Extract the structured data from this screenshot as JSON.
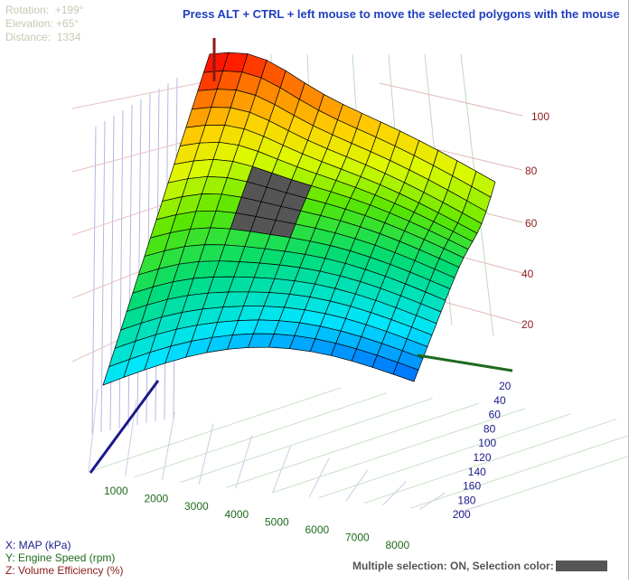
{
  "hud": {
    "rotation_label": "Rotation:",
    "rotation_value": "+199°",
    "elevation_label": "Elevation:",
    "elevation_value": "+65°",
    "distance_label": "Distance:",
    "distance_value": "1334"
  },
  "hint": "Press ALT + CTRL + left mouse to move the selected polygons with the mouse",
  "legend": {
    "x": "X: MAP (kPa)",
    "y": "Y: Engine Speed (rpm)",
    "z": "Z: Volume Efficiency (%)"
  },
  "status": {
    "text": "Multiple selection: ON, Selection color:",
    "selection_color": "#555555"
  },
  "axes": {
    "z_ticks": [
      "20",
      "40",
      "60",
      "80",
      "100"
    ],
    "x_ticks": [
      "20",
      "40",
      "60",
      "80",
      "100",
      "120",
      "140",
      "160",
      "180",
      "200"
    ],
    "y_ticks": [
      "1000",
      "2000",
      "3000",
      "4000",
      "5000",
      "6000",
      "7000",
      "8000"
    ],
    "colors": {
      "x": "#1a1a8c",
      "y": "#1f6a1f",
      "z": "#8c1a1a"
    }
  },
  "chart_data": {
    "type": "surface3d",
    "x_label": "MAP (kPa)",
    "y_label": "Engine Speed (rpm)",
    "z_label": "Volume Efficiency (%)",
    "x_range": [
      20,
      200
    ],
    "y_range": [
      1000,
      8000
    ],
    "z_range": [
      0,
      100
    ],
    "rotation_deg": 199,
    "elevation_deg": 65,
    "selection": {
      "rows": [
        8,
        11
      ],
      "cols": [
        4,
        7
      ]
    }
  }
}
